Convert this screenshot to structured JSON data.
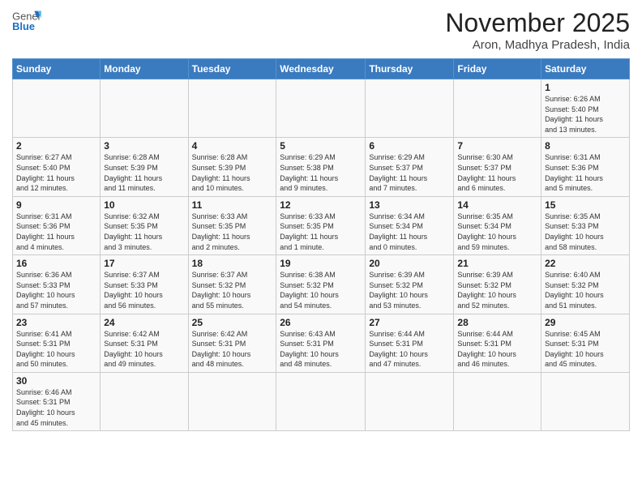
{
  "header": {
    "logo_general": "General",
    "logo_blue": "Blue",
    "month": "November 2025",
    "location": "Aron, Madhya Pradesh, India"
  },
  "weekdays": [
    "Sunday",
    "Monday",
    "Tuesday",
    "Wednesday",
    "Thursday",
    "Friday",
    "Saturday"
  ],
  "days": {
    "1": {
      "sunrise": "6:26 AM",
      "sunset": "5:40 PM",
      "daylight": "11 hours and 13 minutes."
    },
    "2": {
      "sunrise": "6:27 AM",
      "sunset": "5:40 PM",
      "daylight": "11 hours and 12 minutes."
    },
    "3": {
      "sunrise": "6:28 AM",
      "sunset": "5:39 PM",
      "daylight": "11 hours and 11 minutes."
    },
    "4": {
      "sunrise": "6:28 AM",
      "sunset": "5:39 PM",
      "daylight": "11 hours and 10 minutes."
    },
    "5": {
      "sunrise": "6:29 AM",
      "sunset": "5:38 PM",
      "daylight": "11 hours and 9 minutes."
    },
    "6": {
      "sunrise": "6:29 AM",
      "sunset": "5:37 PM",
      "daylight": "11 hours and 7 minutes."
    },
    "7": {
      "sunrise": "6:30 AM",
      "sunset": "5:37 PM",
      "daylight": "11 hours and 6 minutes."
    },
    "8": {
      "sunrise": "6:31 AM",
      "sunset": "5:36 PM",
      "daylight": "11 hours and 5 minutes."
    },
    "9": {
      "sunrise": "6:31 AM",
      "sunset": "5:36 PM",
      "daylight": "11 hours and 4 minutes."
    },
    "10": {
      "sunrise": "6:32 AM",
      "sunset": "5:35 PM",
      "daylight": "11 hours and 3 minutes."
    },
    "11": {
      "sunrise": "6:33 AM",
      "sunset": "5:35 PM",
      "daylight": "11 hours and 2 minutes."
    },
    "12": {
      "sunrise": "6:33 AM",
      "sunset": "5:35 PM",
      "daylight": "11 hours and 1 minute."
    },
    "13": {
      "sunrise": "6:34 AM",
      "sunset": "5:34 PM",
      "daylight": "11 hours and 0 minutes."
    },
    "14": {
      "sunrise": "6:35 AM",
      "sunset": "5:34 PM",
      "daylight": "10 hours and 59 minutes."
    },
    "15": {
      "sunrise": "6:35 AM",
      "sunset": "5:33 PM",
      "daylight": "10 hours and 58 minutes."
    },
    "16": {
      "sunrise": "6:36 AM",
      "sunset": "5:33 PM",
      "daylight": "10 hours and 57 minutes."
    },
    "17": {
      "sunrise": "6:37 AM",
      "sunset": "5:33 PM",
      "daylight": "10 hours and 56 minutes."
    },
    "18": {
      "sunrise": "6:37 AM",
      "sunset": "5:32 PM",
      "daylight": "10 hours and 55 minutes."
    },
    "19": {
      "sunrise": "6:38 AM",
      "sunset": "5:32 PM",
      "daylight": "10 hours and 54 minutes."
    },
    "20": {
      "sunrise": "6:39 AM",
      "sunset": "5:32 PM",
      "daylight": "10 hours and 53 minutes."
    },
    "21": {
      "sunrise": "6:39 AM",
      "sunset": "5:32 PM",
      "daylight": "10 hours and 52 minutes."
    },
    "22": {
      "sunrise": "6:40 AM",
      "sunset": "5:32 PM",
      "daylight": "10 hours and 51 minutes."
    },
    "23": {
      "sunrise": "6:41 AM",
      "sunset": "5:31 PM",
      "daylight": "10 hours and 50 minutes."
    },
    "24": {
      "sunrise": "6:42 AM",
      "sunset": "5:31 PM",
      "daylight": "10 hours and 49 minutes."
    },
    "25": {
      "sunrise": "6:42 AM",
      "sunset": "5:31 PM",
      "daylight": "10 hours and 48 minutes."
    },
    "26": {
      "sunrise": "6:43 AM",
      "sunset": "5:31 PM",
      "daylight": "10 hours and 48 minutes."
    },
    "27": {
      "sunrise": "6:44 AM",
      "sunset": "5:31 PM",
      "daylight": "10 hours and 47 minutes."
    },
    "28": {
      "sunrise": "6:44 AM",
      "sunset": "5:31 PM",
      "daylight": "10 hours and 46 minutes."
    },
    "29": {
      "sunrise": "6:45 AM",
      "sunset": "5:31 PM",
      "daylight": "10 hours and 45 minutes."
    },
    "30": {
      "sunrise": "6:46 AM",
      "sunset": "5:31 PM",
      "daylight": "10 hours and 45 minutes."
    }
  }
}
